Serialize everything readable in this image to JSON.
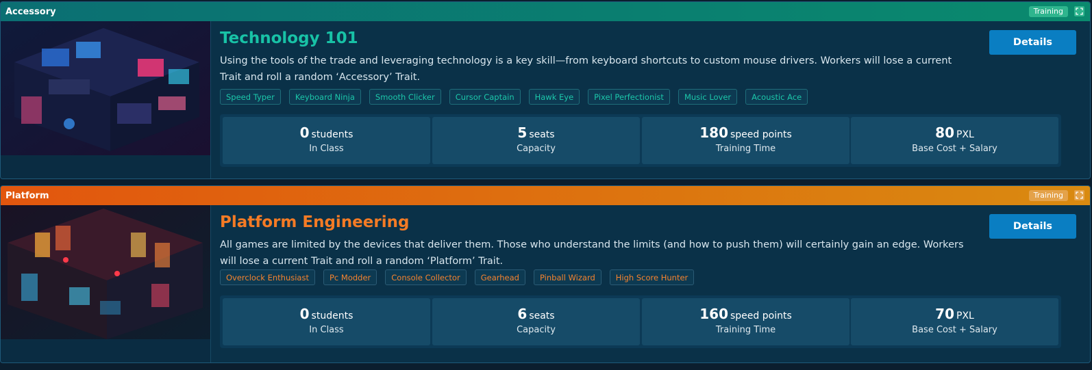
{
  "cards": [
    {
      "header": "Accessory",
      "badge": "Training",
      "title": "Technology 101",
      "description": "Using the tools of the trade and leveraging technology is a key skill—from keyboard shortcuts to custom mouse drivers. Workers will lose a current Trait and roll a random ‘Accessory’ Trait.",
      "details_label": "Details",
      "tags": [
        "Speed Typer",
        "Keyboard Ninja",
        "Smooth Clicker",
        "Cursor Captain",
        "Hawk Eye",
        "Pixel Perfectionist",
        "Music Lover",
        "Acoustic Ace"
      ],
      "stats": [
        {
          "value": "0",
          "unit": "students",
          "label": "In Class"
        },
        {
          "value": "5",
          "unit": "seats",
          "label": "Capacity"
        },
        {
          "value": "180",
          "unit": "speed points",
          "label": "Training Time"
        },
        {
          "value": "80",
          "unit": "PXL",
          "label": "Base Cost + Salary"
        }
      ],
      "accent": "#18c2a6",
      "header_color": "#0a8a6e"
    },
    {
      "header": "Platform",
      "badge": "Training",
      "title": "Platform Engineering",
      "description": "All games are limited by the devices that deliver them. Those who understand the limits (and how to push them) will certainly gain an edge. Workers will lose a current Trait and roll a random ‘Platform’ Trait.",
      "details_label": "Details",
      "tags": [
        "Overclock Enthusiast",
        "Pc Modder",
        "Console Collector",
        "Gearhead",
        "Pinball Wizard",
        "High Score Hunter"
      ],
      "stats": [
        {
          "value": "0",
          "unit": "students",
          "label": "In Class"
        },
        {
          "value": "6",
          "unit": "seats",
          "label": "Capacity"
        },
        {
          "value": "160",
          "unit": "speed points",
          "label": "Training Time"
        },
        {
          "value": "70",
          "unit": "PXL",
          "label": "Base Cost + Salary"
        }
      ],
      "accent": "#f47b25",
      "header_color": "#e2560e"
    }
  ],
  "icons": {
    "expand": "expand-icon",
    "image_1": "tech-workstation-illustration",
    "image_2": "arcade-room-illustration"
  }
}
